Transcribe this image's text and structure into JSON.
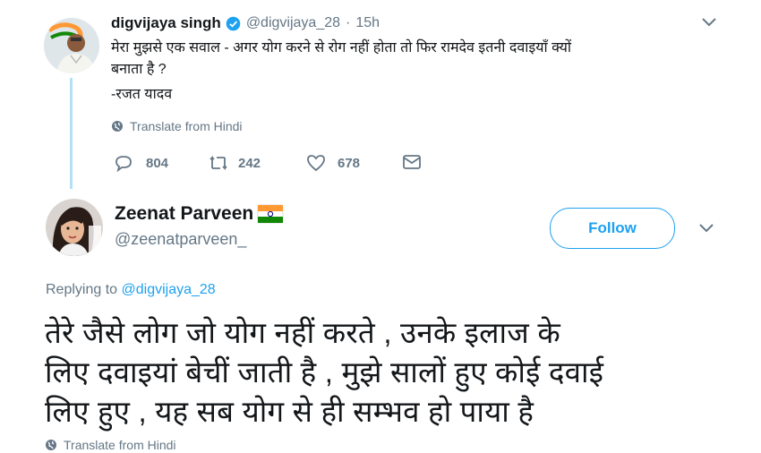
{
  "original_tweet": {
    "author_name": "digvijaya singh",
    "handle": "@digvijaya_28",
    "separator": "·",
    "time": "15h",
    "text_line1": "मेरा मुझसे एक सवाल - अगर योग करने से रोग नहीं होता तो फिर रामदेव इतनी दवाइयाँ क्यों",
    "text_line2": "बनाता है ?",
    "text_line3": "-रजत यादव",
    "translate_label": "Translate from Hindi",
    "reply_count": "804",
    "retweet_count": "242",
    "like_count": "678",
    "colors": {
      "verified": "#1da1f2"
    }
  },
  "reply_tweet": {
    "author_name": "Zeenat Parveen",
    "flag": "india-flag-emoji",
    "handle": "@zeenatparveen_",
    "follow_label": "Follow",
    "replying_prefix": "Replying to",
    "replying_to": "@digvijaya_28",
    "text_line1": "तेरे जैसे लोग जो योग नहीं करते , उनके इलाज के",
    "text_line2": "लिए दवाइयां बेचीं जाती है , मुझे सालों हुए कोई दवाई",
    "text_line3": "लिए हुए , यह सब योग से ही सम्भव हो पाया है",
    "translate_label": "Translate from Hindi"
  },
  "colors": {
    "accent": "#1da1f2",
    "thread_line": "#b3e0f8",
    "muted": "#657786"
  }
}
